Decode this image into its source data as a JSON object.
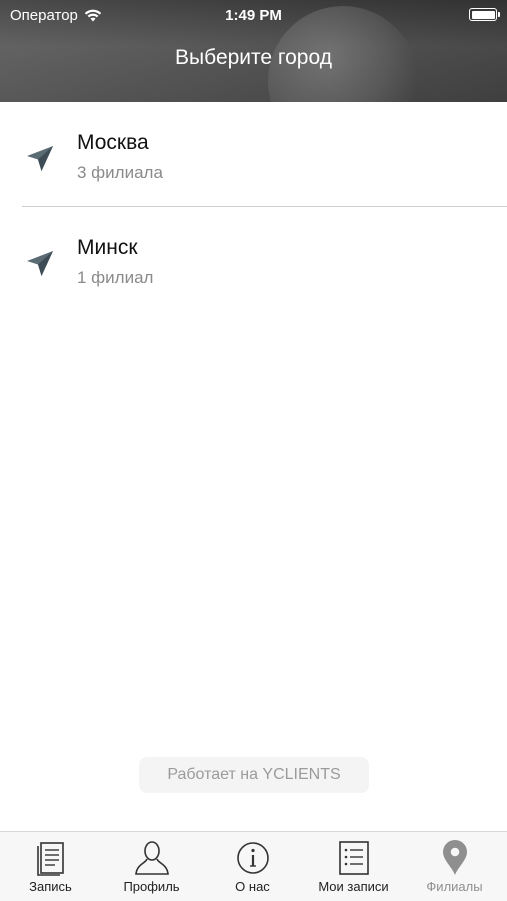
{
  "status_bar": {
    "carrier": "Оператор",
    "time": "1:49 PM"
  },
  "header": {
    "title": "Выберите город"
  },
  "cities": [
    {
      "name": "Москва",
      "count": "3 филиала",
      "icon": "location-arrow-icon"
    },
    {
      "name": "Минск",
      "count": "1 филиал",
      "icon": "location-arrow-icon"
    }
  ],
  "footer": {
    "powered_by": "Работает на YCLIENTS"
  },
  "tabs": [
    {
      "label": "Запись",
      "icon": "document-icon"
    },
    {
      "label": "Профиль",
      "icon": "profile-icon"
    },
    {
      "label": "О нас",
      "icon": "info-icon"
    },
    {
      "label": "Мои записи",
      "icon": "list-icon"
    },
    {
      "label": "Филиалы",
      "icon": "map-pin-icon",
      "active": true
    }
  ],
  "colors": {
    "accent_icon": "#5b6b73",
    "active_tab": "#8f8f8f"
  }
}
